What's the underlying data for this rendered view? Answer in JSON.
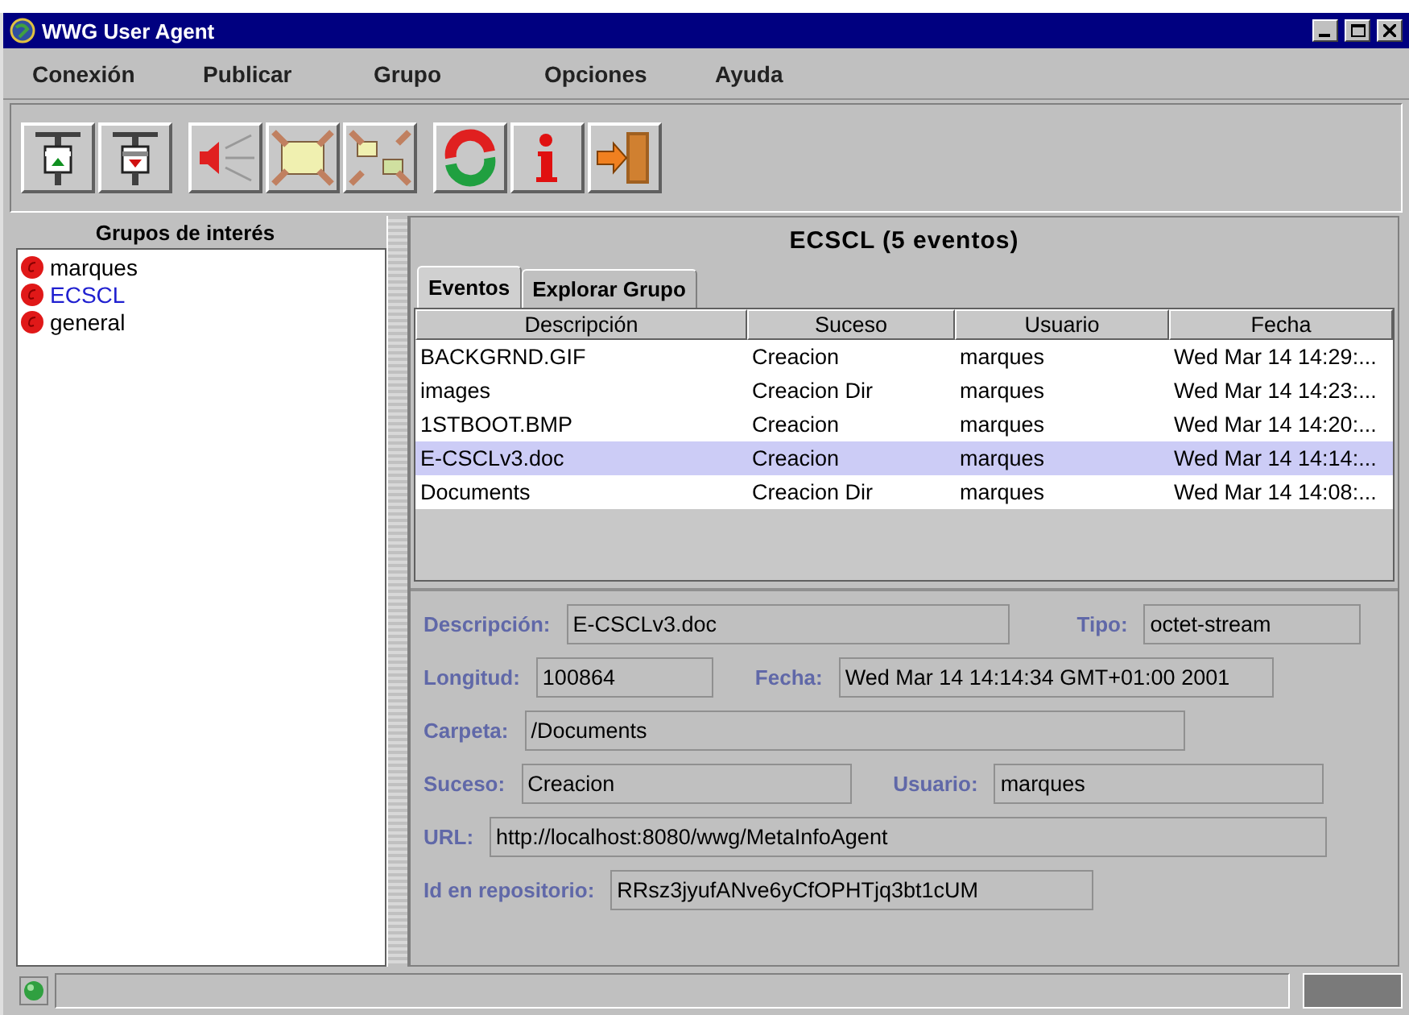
{
  "window": {
    "title": "WWG User Agent"
  },
  "menu": [
    "Conexión",
    "Publicar",
    "Grupo",
    "Opciones",
    "Ayuda"
  ],
  "toolbar": [
    [
      {
        "kind": "connect"
      },
      {
        "kind": "disconnect"
      }
    ],
    [
      {
        "kind": "announce"
      },
      {
        "kind": "join"
      },
      {
        "kind": "split"
      }
    ],
    [
      {
        "kind": "refresh"
      },
      {
        "kind": "info"
      },
      {
        "kind": "exit"
      }
    ]
  ],
  "sidebar": {
    "title": "Grupos de interés",
    "items": [
      {
        "label": "marques",
        "selected": false
      },
      {
        "label": "ECSCL",
        "selected": true
      },
      {
        "label": "general",
        "selected": false
      }
    ]
  },
  "panel": {
    "title": "ECSCL  (5 eventos)",
    "tabs": [
      {
        "label": "Eventos",
        "selected": true
      },
      {
        "label": "Explorar Grupo",
        "selected": false
      }
    ],
    "table": {
      "columns": [
        "Descripción",
        "Suceso",
        "Usuario",
        "Fecha"
      ],
      "rows": [
        {
          "cells": [
            "BACKGRND.GIF",
            "Creacion",
            "marques",
            "Wed Mar 14 14:29:..."
          ],
          "selected": false
        },
        {
          "cells": [
            "images",
            "Creacion Dir",
            "marques",
            "Wed Mar 14 14:23:..."
          ],
          "selected": false
        },
        {
          "cells": [
            "1STBOOT.BMP",
            "Creacion",
            "marques",
            "Wed Mar 14 14:20:..."
          ],
          "selected": false
        },
        {
          "cells": [
            "E-CSCLv3.doc",
            "Creacion",
            "marques",
            "Wed Mar 14 14:14:..."
          ],
          "selected": true
        },
        {
          "cells": [
            "Documents",
            "Creacion Dir",
            "marques",
            "Wed Mar 14 14:08:..."
          ],
          "selected": false
        }
      ]
    },
    "details": [
      [
        {
          "label": "Descripción:",
          "value": "E-CSCLv3.doc"
        },
        {
          "label": "Tipo:",
          "value": "octet-stream"
        }
      ],
      [
        {
          "label": "Longitud:",
          "value": "100864"
        },
        {
          "label": "Fecha:",
          "value": "Wed Mar 14 14:14:34 GMT+01:00 2001"
        }
      ],
      [
        {
          "label": "Carpeta:",
          "value": "/Documents"
        }
      ],
      [
        {
          "label": "Suceso:",
          "value": "Creacion"
        },
        {
          "label": "Usuario:",
          "value": "marques"
        }
      ],
      [
        {
          "label": "URL:",
          "value": "http://localhost:8080/wwg/MetaInfoAgent"
        }
      ],
      [
        {
          "label": "Id en repositorio:",
          "value": "RRsz3jyufANve6yCfOPHTjq3bt1cUM"
        }
      ]
    ]
  }
}
